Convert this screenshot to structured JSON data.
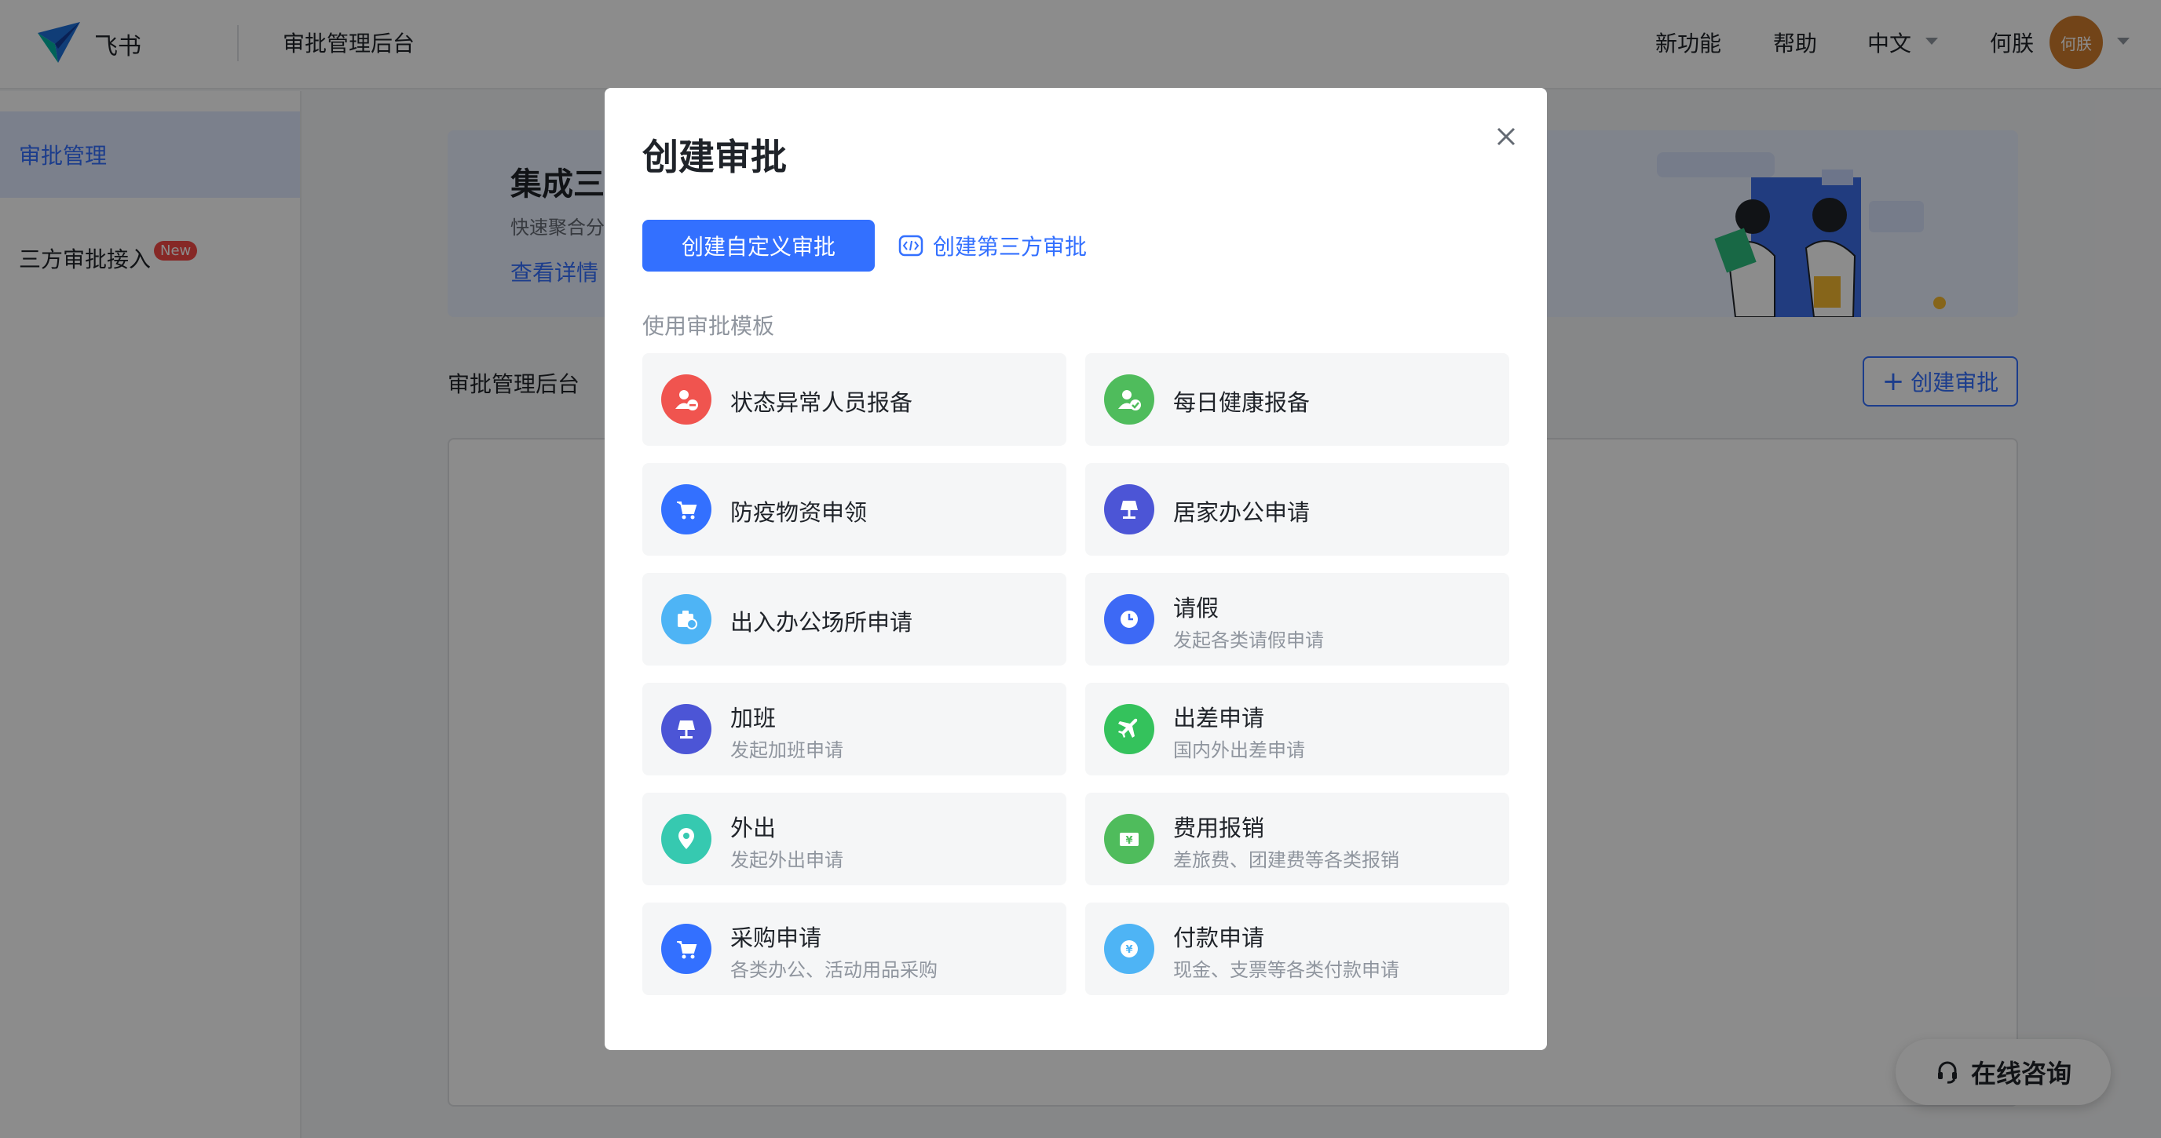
{
  "header": {
    "logo_text": "飞书",
    "title": "审批管理后台",
    "links": [
      "新功能",
      "帮助"
    ],
    "language": "中文",
    "user_name": "何朕",
    "avatar_text": "何朕"
  },
  "sidebar": {
    "items": [
      {
        "label": "审批管理",
        "active": true
      },
      {
        "label": "三方审批接入",
        "badge": "New"
      }
    ]
  },
  "main": {
    "banner": {
      "title": "集成三",
      "subtitle": "快速聚合分",
      "link": "查看详情"
    },
    "section_label": "审批管理后台",
    "create_button": "创建审批"
  },
  "consult_button": "在线咨询",
  "modal": {
    "title": "创建审批",
    "primary_button": "创建自定义审批",
    "third_party_button": "创建第三方审批",
    "template_label": "使用审批模板",
    "templates": [
      {
        "name": "状态异常人员报备",
        "desc": "",
        "color": "#f0544f",
        "icon": "person-minus-icon"
      },
      {
        "name": "每日健康报备",
        "desc": "",
        "color": "#4fbc5c",
        "icon": "person-check-icon"
      },
      {
        "name": "防疫物资申领",
        "desc": "",
        "color": "#3370ff",
        "icon": "cart-icon"
      },
      {
        "name": "居家办公申请",
        "desc": "",
        "color": "#4c55d6",
        "icon": "lamp-icon"
      },
      {
        "name": "出入办公场所申请",
        "desc": "",
        "color": "#4eb4f5",
        "icon": "badge-icon"
      },
      {
        "name": "请假",
        "desc": "发起各类请假申请",
        "color": "#3d69f5",
        "icon": "clock-icon"
      },
      {
        "name": "加班",
        "desc": "发起加班申请",
        "color": "#4c55d6",
        "icon": "lamp-icon"
      },
      {
        "name": "出差申请",
        "desc": "国内外出差申请",
        "color": "#34c25c",
        "icon": "plane-icon"
      },
      {
        "name": "外出",
        "desc": "发起外出申请",
        "color": "#36c9b0",
        "icon": "location-pin-icon"
      },
      {
        "name": "费用报销",
        "desc": "差旅费、团建费等各类报销",
        "color": "#4fbc5c",
        "icon": "yen-bill-icon"
      },
      {
        "name": "采购申请",
        "desc": "各类办公、活动用品采购",
        "color": "#3370ff",
        "icon": "cart-icon"
      },
      {
        "name": "付款申请",
        "desc": "现金、支票等各类付款申请",
        "color": "#4eb4f5",
        "icon": "yen-coin-icon"
      }
    ]
  }
}
